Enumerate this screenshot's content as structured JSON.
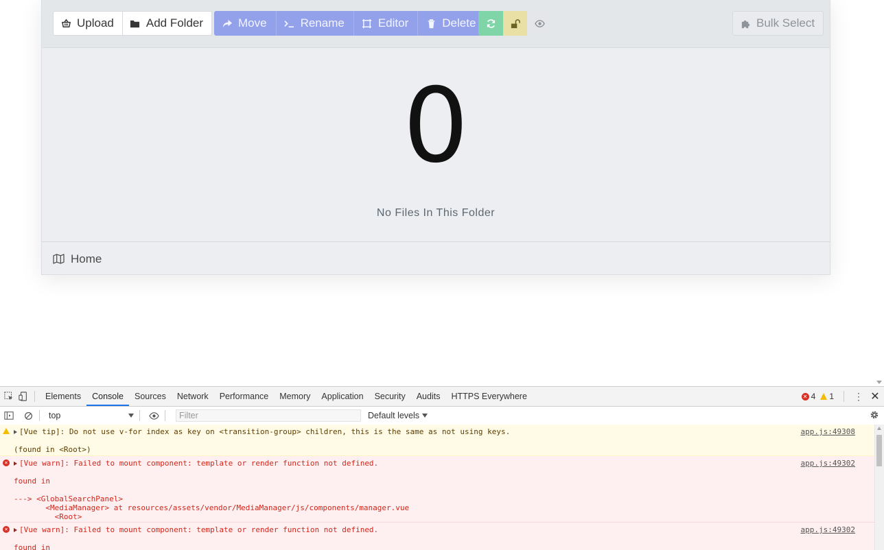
{
  "toolbar": {
    "upload_label": "Upload",
    "add_folder_label": "Add Folder",
    "move_label": "Move",
    "rename_label": "Rename",
    "editor_label": "Editor",
    "delete_label": "Delete",
    "bulk_select_label": "Bulk Select"
  },
  "empty_state": {
    "count": "0",
    "message": "No Files In This Folder"
  },
  "breadcrumb": {
    "home_label": "Home"
  },
  "devtools": {
    "tabs": [
      "Elements",
      "Console",
      "Sources",
      "Network",
      "Performance",
      "Memory",
      "Application",
      "Security",
      "Audits",
      "HTTPS Everywhere"
    ],
    "active_tab": "Console",
    "error_count": "4",
    "warning_count": "1",
    "context": "top",
    "filter_placeholder": "Filter",
    "levels_label": "Default levels",
    "messages": [
      {
        "level": "warning",
        "text": "[Vue tip]: Do not use v-for index as key on <transition-group> children, this is the same as not using keys.",
        "detail": [
          "",
          "(found in <Root>)"
        ],
        "source": "app.js:49308"
      },
      {
        "level": "error",
        "text": "[Vue warn]: Failed to mount component: template or render function not defined.",
        "detail": [
          "",
          "found in",
          "",
          "---> <GlobalSearchPanel>",
          "       <MediaManager> at resources/assets/vendor/MediaManager/js/components/manager.vue",
          "         <Root>"
        ],
        "source": "app.js:49302"
      },
      {
        "level": "error",
        "text": "[Vue warn]: Failed to mount component: template or render function not defined.",
        "detail": [
          "",
          "found in"
        ],
        "source": "app.js:49302"
      }
    ]
  },
  "colors": {
    "primary_button": "#93a0ea",
    "success_button": "#7fd5a8",
    "warning_button": "#e8e0a4",
    "devtools_active_tab": "#1a73e8",
    "error_text": "#d1261b"
  },
  "icons": {
    "upload": "basket-icon",
    "add_folder": "folder-icon",
    "move": "share-arrow-icon",
    "rename": "terminal-icon",
    "editor": "crop-icon",
    "delete": "trash-icon",
    "refresh": "refresh-icon",
    "lock": "unlock-icon",
    "preview": "eye-icon",
    "bulk_select": "puzzle-icon",
    "home": "map-icon"
  }
}
